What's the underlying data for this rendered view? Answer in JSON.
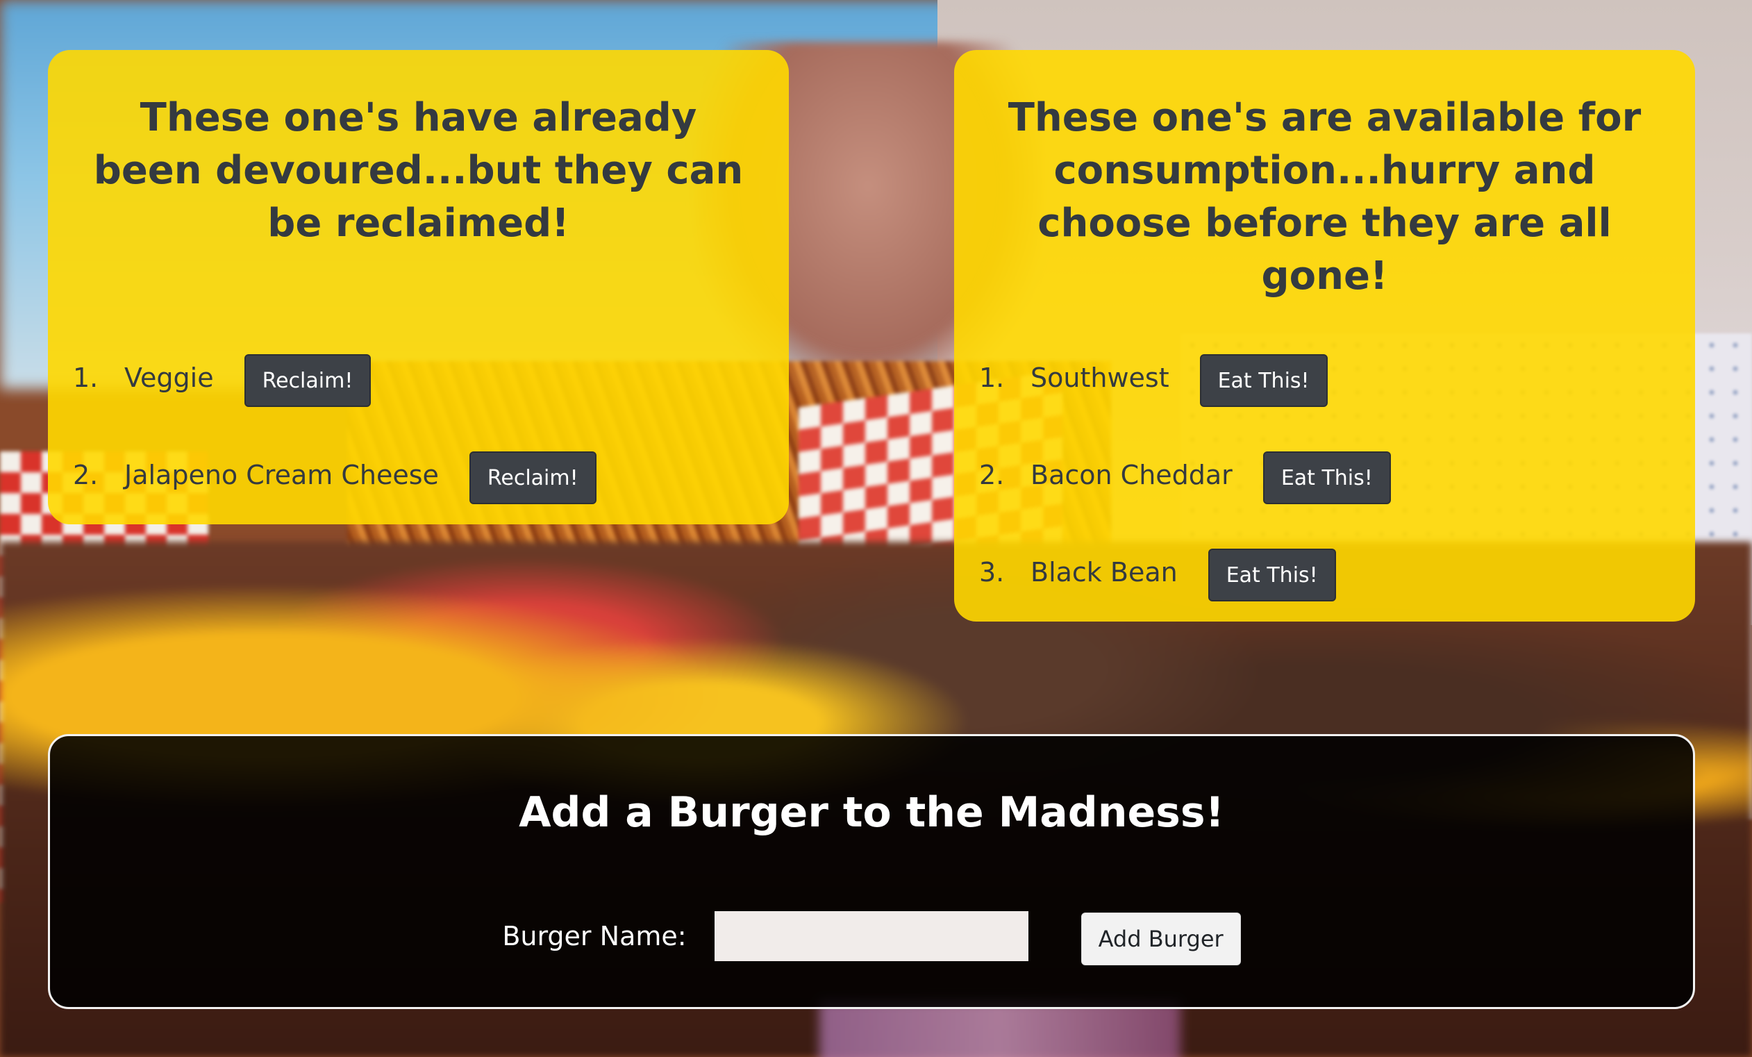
{
  "devoured": {
    "heading": "These one's have already been devoured...but they can be reclaimed!",
    "items": [
      {
        "number": "1.",
        "name": "Veggie",
        "button": "Reclaim!"
      },
      {
        "number": "2.",
        "name": "Jalapeno Cream Cheese",
        "button": "Reclaim!"
      }
    ]
  },
  "available": {
    "heading": "These one's are available for consumption...hurry and choose before they are all gone!",
    "items": [
      {
        "number": "1.",
        "name": "Southwest",
        "button": "Eat This!"
      },
      {
        "number": "2.",
        "name": "Bacon Cheddar",
        "button": "Eat This!"
      },
      {
        "number": "3.",
        "name": "Black Bean",
        "button": "Eat This!"
      }
    ]
  },
  "add_form": {
    "heading": "Add a Burger to the Madness!",
    "label": "Burger Name:",
    "input_value": "",
    "button": "Add Burger"
  },
  "colors": {
    "panel_yellow": "#FFD800",
    "button_dark": "#3D4147",
    "text_dark": "#343A40",
    "form_background": "#000000"
  }
}
